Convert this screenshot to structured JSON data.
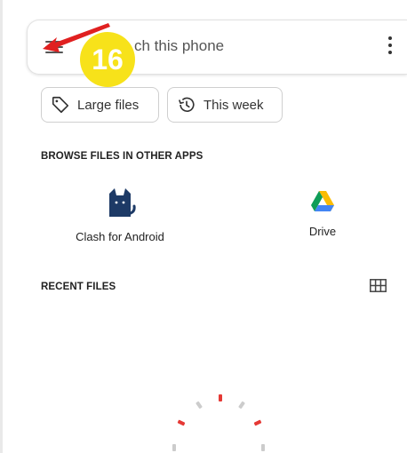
{
  "search": {
    "placeholder_visible": "ch this phone"
  },
  "annotation": {
    "step_number": "16",
    "badge_color": "#f7e21a",
    "arrow_color": "#e02020"
  },
  "chips": [
    {
      "label": "Large files",
      "icon": "tag-icon"
    },
    {
      "label": "This week",
      "icon": "history-clock-icon"
    }
  ],
  "browse": {
    "title": "BROWSE FILES IN OTHER APPS",
    "apps": [
      {
        "name": "Clash for Android",
        "icon": "clash-cat-icon",
        "color": "#1d3a66"
      },
      {
        "name": "Drive",
        "icon": "google-drive-icon"
      }
    ]
  },
  "recent": {
    "title": "RECENT FILES",
    "view_toggle_icon": "grid-view-icon"
  },
  "loading": {
    "indicator": "loading-spinner",
    "accent_color": "#e53935"
  }
}
